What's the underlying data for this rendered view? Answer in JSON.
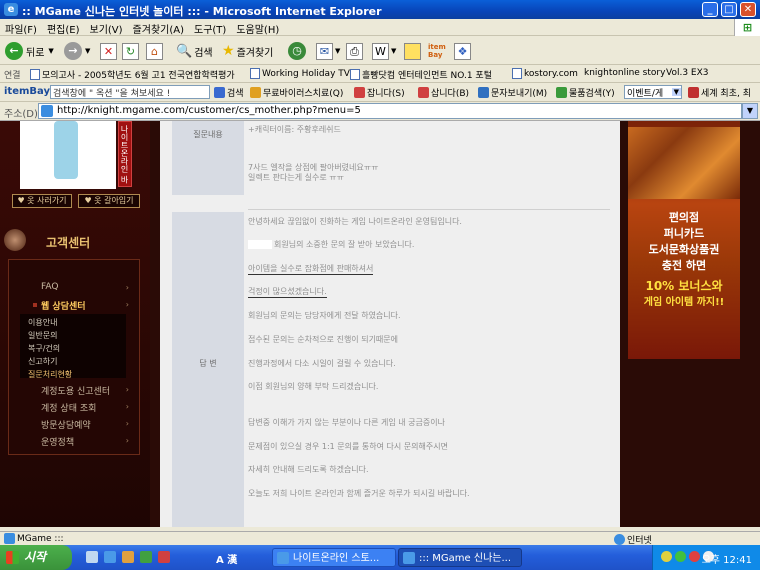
{
  "window": {
    "title": ":: MGame 신나는 인터넷 놀이터 ::: - Microsoft Internet Explorer",
    "min": "_",
    "max": "□",
    "close": "✕"
  },
  "menu": [
    "파일(F)",
    "편집(E)",
    "보기(V)",
    "즐겨찾기(A)",
    "도구(T)",
    "도움말(H)"
  ],
  "toolbar": {
    "back": "뒤로",
    "search": "검색",
    "favorites": "즐겨찾기",
    "itembay": "item Bay"
  },
  "links": {
    "label": "연결",
    "items": [
      "모의고사 - 2005학년도 6월 고1 전국연합학력평가",
      "Working Holiday TV",
      "흘빵닷컴 엔터테인먼트 NO.1 포털",
      "kostory.com",
      "knightonline story",
      "Vol.3 EX3"
    ]
  },
  "itembar": {
    "logo": "itemBay",
    "search_placeholder": "검색창에 \" 옥션 \"을 쳐보세요 !",
    "search": "검색",
    "virus": "무료바이러스치료(Q)",
    "jobs": "잡니다(S)",
    "shop": "삽니다(B)",
    "sms": "문자보내기(M)",
    "item_search": "물품검색(Y)",
    "event": "이벤트/게",
    "world": "세계 최초, 최"
  },
  "address": {
    "label": "주소(D)",
    "url": "http://knight.mgame.com/customer/cs_mother.php?menu=5"
  },
  "left": {
    "vertical_tag": "나이트온라인 바타",
    "btn_buy": "♥ 옷 사러가기",
    "btn_change": "♥ 옷 갈아입기",
    "section_title": "고객센터",
    "menu": [
      {
        "label": "FAQ",
        "active": false
      },
      {
        "label": "웹 상담센터",
        "active": true
      },
      {
        "label": "계정도용 신고센터",
        "active": false
      },
      {
        "label": "계정 상태 조회",
        "active": false
      },
      {
        "label": "방문상담예약",
        "active": false
      },
      {
        "label": "운영정책",
        "active": false
      }
    ],
    "submenu": [
      "이용안내",
      "일반문의",
      "복구/건의",
      "신고하기",
      "질문처리현황"
    ]
  },
  "main": {
    "question_label": "질문내용",
    "question_lines": [
      "+캐릭터이름: 주황후레쉬드",
      "7사드 엘작을 상점에 팔아버렸네요ㅠㅠ",
      "일렉트 판다는게 실수로 ㅠㅠ"
    ],
    "answer_label": "답 변",
    "answer_lines": [
      "안녕하세요 끊임없이 진화하는 게임 나이트온라인 운영팀입니다.",
      "회원님의 소중한 문의 잘 받아 보았습니다.",
      "아이템을 실수로 잡화점에 판매하셔서",
      "걱정이 많으셨겠습니다.",
      "회원님의 문의는 담당자에게 전달 하였습니다.",
      "접수된 문의는 순차적으로 진행이 되기때문에",
      "진행과정에서 다소 시일이 걸릴 수 있습니다.",
      "이점 회원님의 양해 부탁 드리겠습니다.",
      "답변중 이해가 가지 않는 부분이나 다른 게임 내 궁금증이나",
      "문제점이 있으실 경우 1:1 문의를 통하여 다시 문의해주시면",
      "자세히 안내해 드리도록 하겠습니다.",
      "오늘도 저희 나이트 온라인과 함께 즐거운 하루가 되시길 바랍니다."
    ]
  },
  "banner": {
    "lines": [
      "편의점",
      "퍼니카드",
      "도서문화상품권",
      "충전 하면"
    ],
    "promo1": "10% 보너스와",
    "promo2": "게임 아이템 까지!!"
  },
  "status": {
    "text": "MGame :::",
    "zone": "인터넷"
  },
  "taskbar": {
    "start": "시작",
    "task1": "나이트온라인 스토...",
    "task2": "::: MGame 신나는...",
    "clock": "오후 12:41",
    "lang": "A 漢"
  }
}
